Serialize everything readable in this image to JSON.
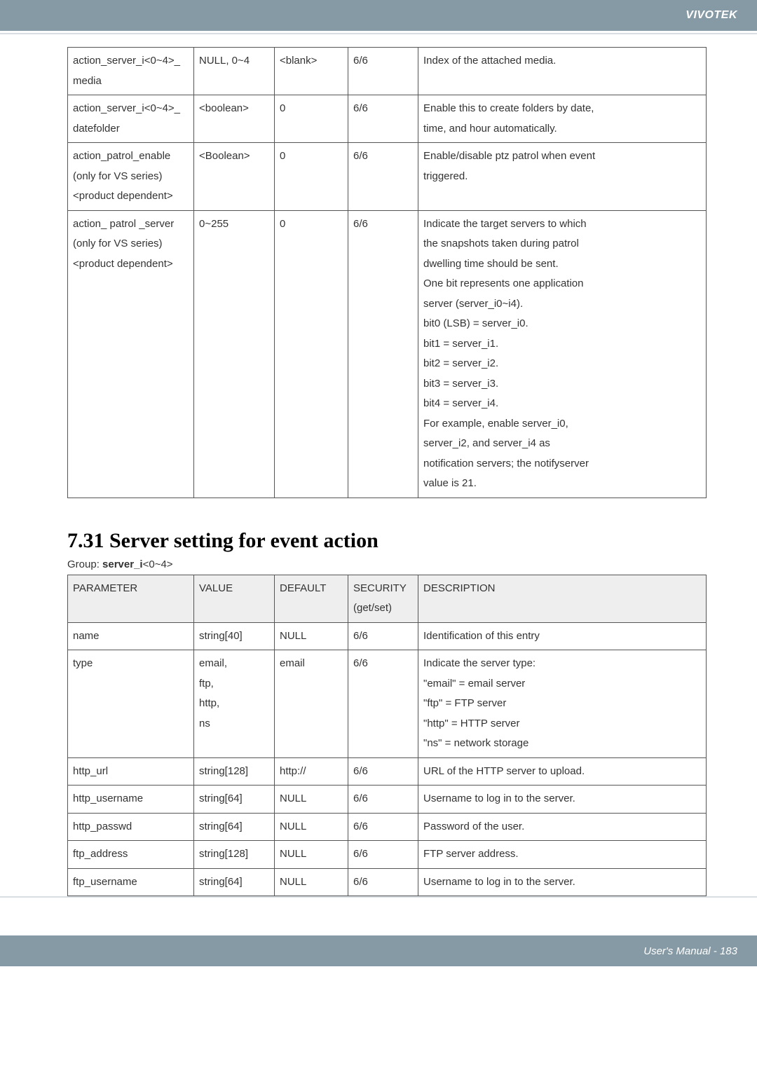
{
  "brand": "VIVOTEK",
  "section_title": "7.31 Server setting for event action",
  "group_prefix": "Group: ",
  "group_name": "server_i",
  "group_suffix": "<0~4>",
  "footer_text": "User's Manual - 183",
  "table1": {
    "rows": [
      {
        "param_lines": [
          "action_server_i<0~4>_",
          "media"
        ],
        "value": "NULL, 0~4",
        "default": "<blank>",
        "security": "6/6",
        "desc_lines": [
          "Index of the attached media."
        ]
      },
      {
        "param_lines": [
          "action_server_i<0~4>_",
          "datefolder"
        ],
        "value": "<boolean>",
        "default": "0",
        "security": "6/6",
        "desc_lines": [
          "Enable this to create folders by date,",
          "time, and hour automatically."
        ]
      },
      {
        "param_lines": [
          "action_patrol_enable",
          "(only for VS series)",
          "<product dependent>"
        ],
        "value": "<Boolean>",
        "default": "0",
        "security": "6/6",
        "desc_lines": [
          "Enable/disable ptz patrol when event",
          "triggered."
        ]
      },
      {
        "param_lines": [
          "action_ patrol _server",
          "(only for VS series)",
          "<product dependent>"
        ],
        "value": "0~255",
        "default": "0",
        "security": "6/6",
        "desc_lines": [
          "Indicate the target servers to which",
          "the snapshots taken during patrol",
          "dwelling time should be sent.",
          "One bit represents one application",
          "server (server_i0~i4).",
          "bit0 (LSB) = server_i0.",
          "bit1 = server_i1.",
          "bit2 = server_i2.",
          "bit3 = server_i3.",
          "bit4 = server_i4.",
          "For example, enable server_i0,",
          "server_i2, and server_i4 as",
          "notification servers; the notifyserver",
          "value is 21."
        ]
      }
    ]
  },
  "table2": {
    "headers": {
      "param": "PARAMETER",
      "value": "VALUE",
      "default": "DEFAULT",
      "security_lines": [
        "SECURITY",
        "(get/set)"
      ],
      "desc": "DESCRIPTION"
    },
    "rows": [
      {
        "param": "name",
        "value": "string[40]",
        "default": "NULL",
        "security": "6/6",
        "desc_lines": [
          "Identification of this entry"
        ]
      },
      {
        "param": "type",
        "value_lines": [
          "email,",
          "ftp,",
          "http,",
          "ns"
        ],
        "default": "email",
        "security": "6/6",
        "desc_lines": [
          "Indicate the server type:",
          "\"email\" = email server",
          "\"ftp\" = FTP server",
          "\"http\" = HTTP server",
          "\"ns\" = network storage"
        ]
      },
      {
        "param": "http_url",
        "value": "string[128]",
        "default": "http://",
        "security": "6/6",
        "desc_lines": [
          "URL of the HTTP server to upload."
        ]
      },
      {
        "param": "http_username",
        "value": "string[64]",
        "default": "NULL",
        "security": "6/6",
        "desc_lines": [
          "Username to log in to the server."
        ]
      },
      {
        "param": "http_passwd",
        "value": "string[64]",
        "default": "NULL",
        "security": "6/6",
        "desc_lines": [
          "Password of the user."
        ]
      },
      {
        "param": "ftp_address",
        "value": "string[128]",
        "default": "NULL",
        "security": "6/6",
        "desc_lines": [
          "FTP server address."
        ]
      },
      {
        "param": "ftp_username",
        "value": "string[64]",
        "default": "NULL",
        "security": "6/6",
        "desc_lines": [
          "Username to log in to the server."
        ]
      }
    ]
  }
}
